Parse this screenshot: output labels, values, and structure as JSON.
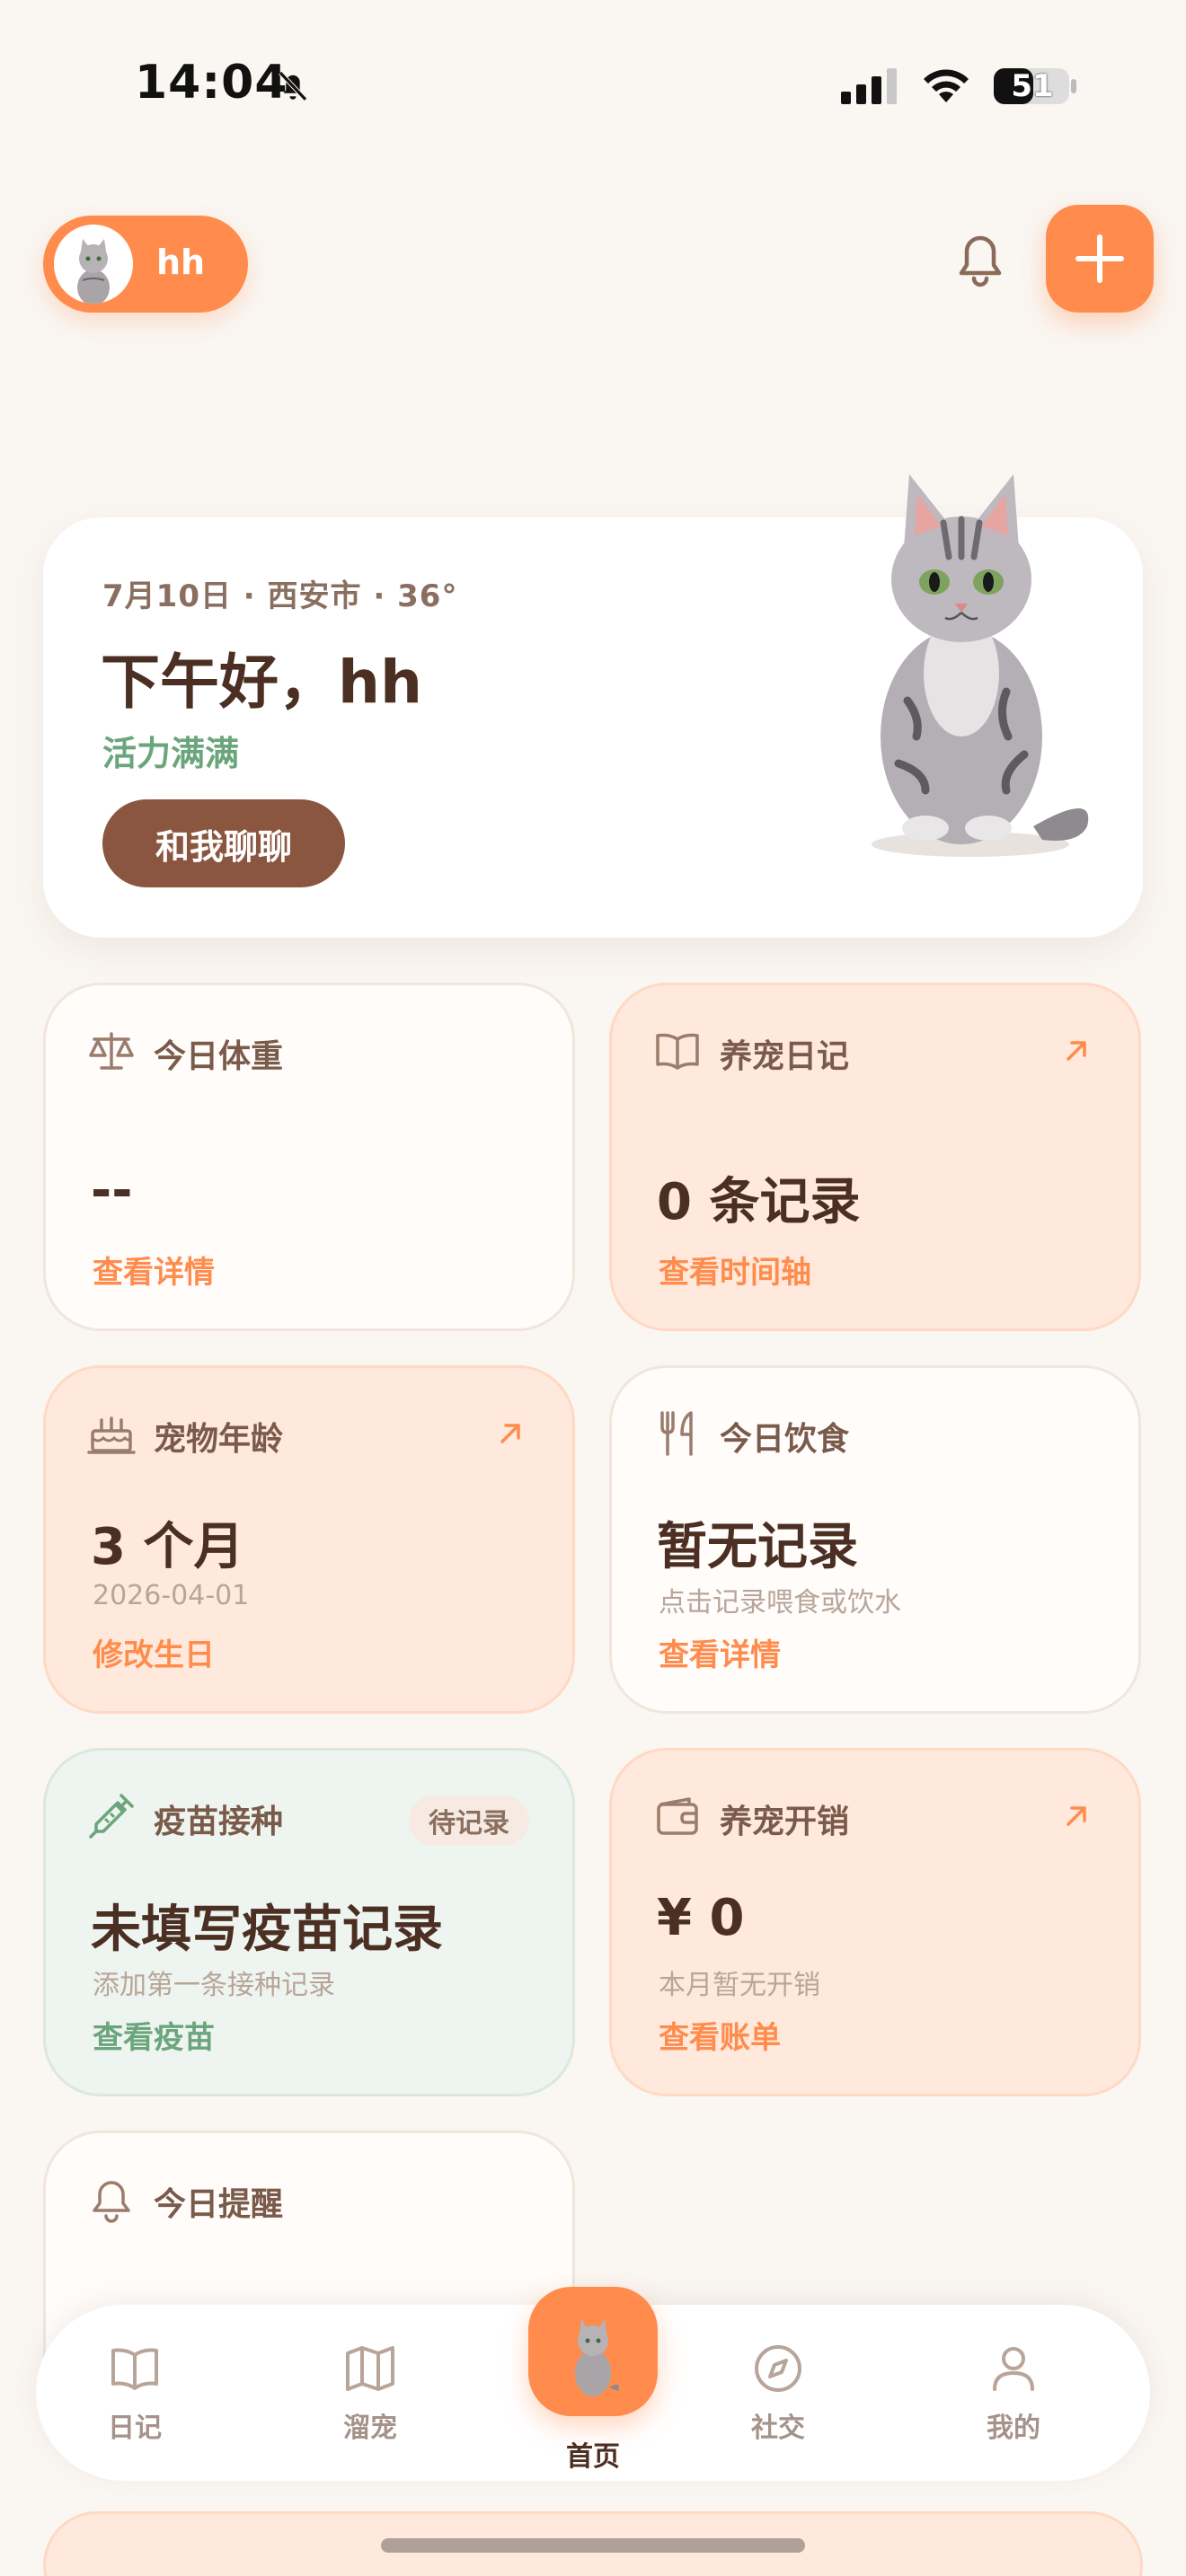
{
  "status_bar": {
    "time": "14:04",
    "battery": "51"
  },
  "header": {
    "user_name": "hh"
  },
  "greeting": {
    "meta": "7月10日 · 西安市 · 36°",
    "title": "下午好，hh",
    "mood": "活力满满",
    "chat_button": "和我聊聊"
  },
  "cards": {
    "weight": {
      "title": "今日体重",
      "value": "--",
      "link": "查看详情"
    },
    "diary": {
      "title": "养宠日记",
      "value": "0 条记录",
      "link": "查看时间轴"
    },
    "age": {
      "title": "宠物年龄",
      "value": "3 个月",
      "sub": "2026-04-01",
      "link": "修改生日"
    },
    "food": {
      "title": "今日饮食",
      "value": "暂无记录",
      "sub": "点击记录喂食或饮水",
      "link": "查看详情"
    },
    "vaccine": {
      "title": "疫苗接种",
      "badge": "待记录",
      "value": "未填写疫苗记录",
      "sub": "添加第一条接种记录",
      "link": "查看疫苗"
    },
    "expense": {
      "title": "养宠开销",
      "value": "¥ 0",
      "sub": "本月暂无开销",
      "link": "查看账单"
    },
    "reminder": {
      "title": "今日提醒"
    }
  },
  "nav": {
    "diary": "日记",
    "walk": "溜宠",
    "home": "首页",
    "social": "社交",
    "mine": "我的"
  },
  "colors": {
    "accent": "#ff8c4d",
    "brown": "#8b5640",
    "green": "#6aa57c"
  }
}
